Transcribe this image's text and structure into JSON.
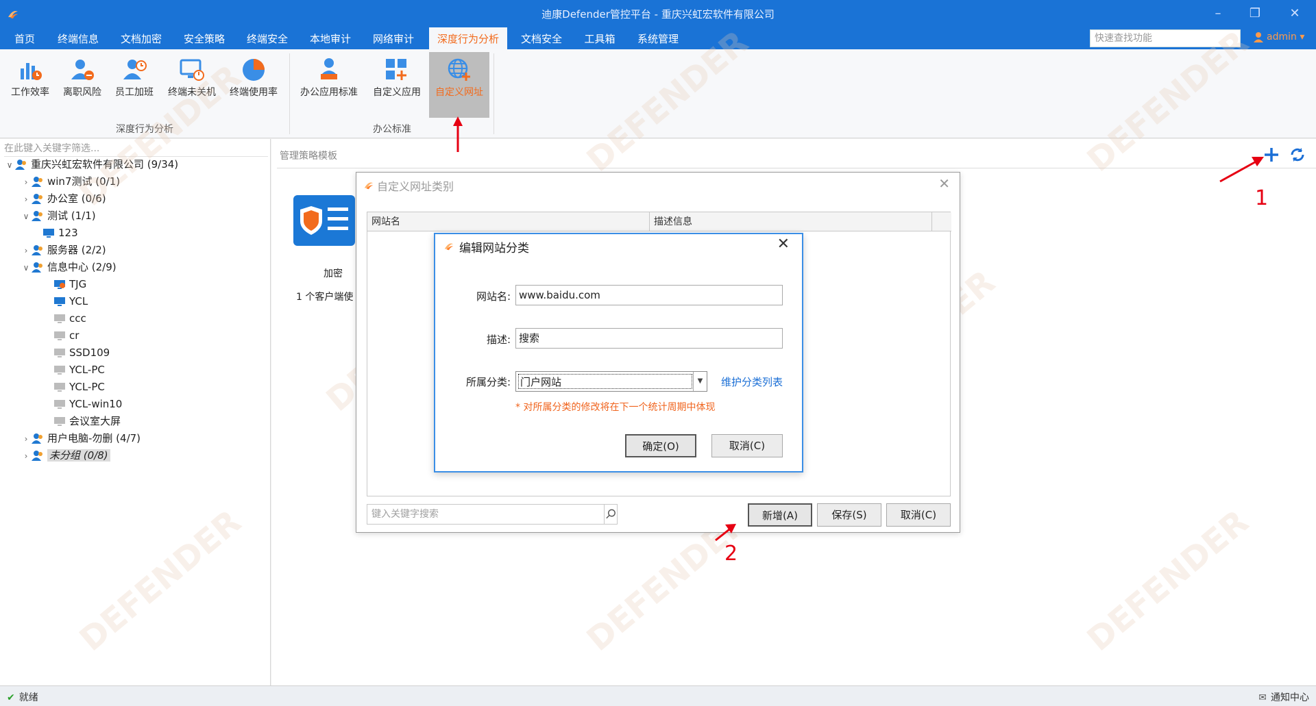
{
  "window": {
    "title": "迪康Defender管控平台 - 重庆兴虹宏软件有限公司"
  },
  "menu": {
    "items": [
      "首页",
      "终端信息",
      "文档加密",
      "安全策略",
      "终端安全",
      "本地审计",
      "网络审计",
      "深度行为分析",
      "文档安全",
      "工具箱",
      "系统管理"
    ],
    "active_index": 7,
    "quick_search_placeholder": "快速查找功能",
    "user": "admin"
  },
  "ribbon": {
    "group1": {
      "label": "深度行为分析",
      "buttons": [
        "工作效率",
        "离职风险",
        "员工加班",
        "终端未关机",
        "终端使用率"
      ]
    },
    "group2": {
      "label": "办公标准",
      "buttons": [
        "办公应用标准",
        "自定义应用",
        "自定义网址"
      ]
    }
  },
  "left_panel": {
    "filter_placeholder": "在此键入关键字筛选...",
    "tree": [
      "重庆兴虹宏软件有限公司 (9/34)",
      "win7测试 (0/1)",
      "办公室 (0/6)",
      "测试 (1/1)",
      "123",
      "服务器 (2/2)",
      "信息中心 (2/9)",
      "TJG",
      "YCL",
      "ccc",
      "cr",
      "SSD109",
      "YCL-PC",
      "YCL-PC",
      "YCL-win10",
      "会议室大屏",
      "用户电脑-勿删 (4/7)",
      "未分组 (0/8)"
    ]
  },
  "main": {
    "heading": "管理策略模板",
    "card_title": "加密",
    "card_desc": "1 个客户端使"
  },
  "dialog_category": {
    "title": "自定义网址类别",
    "col_site": "网站名",
    "col_desc": "描述信息",
    "search_placeholder": "键入关键字搜索",
    "btn_add": "新增(A)",
    "btn_save": "保存(S)",
    "btn_cancel": "取消(C)"
  },
  "dialog_edit": {
    "title": "编辑网站分类",
    "label_site": "网站名:",
    "value_site": "www.baidu.com",
    "label_desc": "描述:",
    "value_desc": "搜索",
    "label_category": "所属分类:",
    "value_category": "门户网站",
    "maintain_link": "维护分类列表",
    "note": "* 对所属分类的修改将在下一个统计周期中体现",
    "btn_ok": "确定(O)",
    "btn_cancel": "取消(C)"
  },
  "annotations": {
    "n1": "1",
    "n2": "2"
  },
  "watermark": "DEFENDER",
  "status": {
    "left": "就绪",
    "right": "通知中心"
  },
  "colors": {
    "titlebar": "#1a73d6",
    "accent_orange": "#f26b1d",
    "dialog_border": "#3a8ee6",
    "annotation_red": "#e60012"
  }
}
